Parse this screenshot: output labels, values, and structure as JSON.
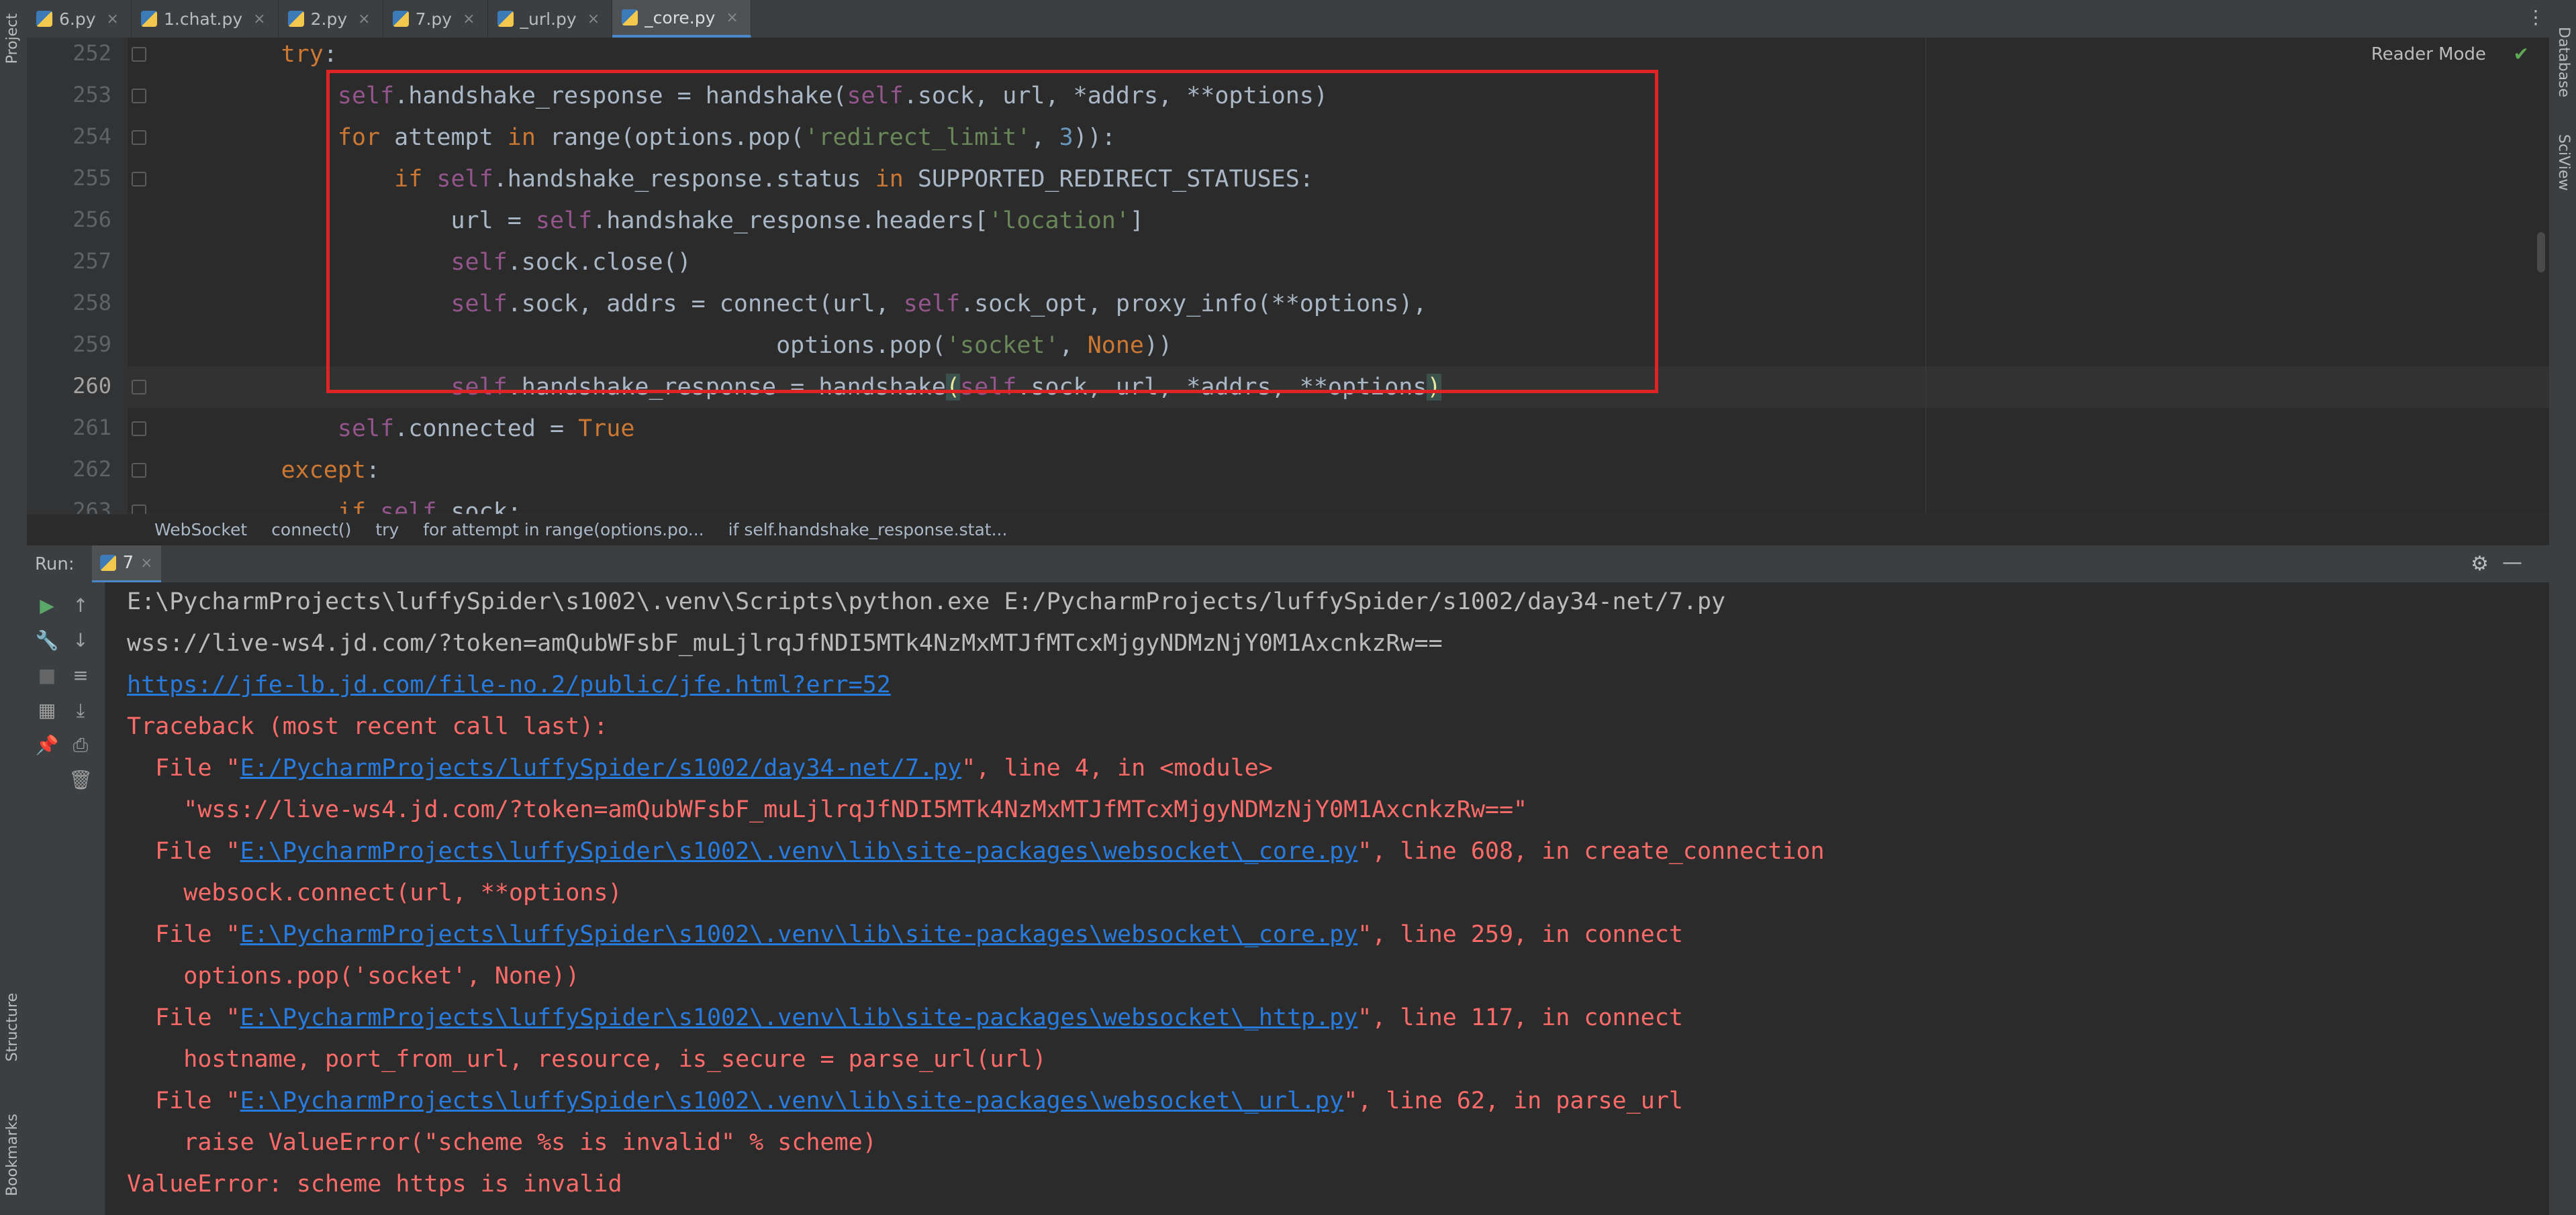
{
  "tabs": [
    {
      "label": "6.py",
      "active": false
    },
    {
      "label": "1.chat.py",
      "active": false
    },
    {
      "label": "2.py",
      "active": false
    },
    {
      "label": "7.py",
      "active": false
    },
    {
      "label": "_url.py",
      "active": false
    },
    {
      "label": "_core.py",
      "active": true
    }
  ],
  "left_tools": {
    "project": "Project",
    "structure": "Structure",
    "bookmarks": "Bookmarks"
  },
  "right_tools": {
    "database": "Database",
    "sciview": "SciView"
  },
  "editor": {
    "reader_mode": "Reader Mode",
    "current_line": 260,
    "lines": [
      {
        "n": "252",
        "indent": "        ",
        "tokens": [
          {
            "t": "try",
            "c": "kw"
          },
          {
            "t": ":",
            "c": ""
          }
        ]
      },
      {
        "n": "253",
        "indent": "            ",
        "tokens": [
          {
            "t": "self",
            "c": "self"
          },
          {
            "t": ".handshake_response = handshake(",
            "c": ""
          },
          {
            "t": "self",
            "c": "self"
          },
          {
            "t": ".sock, url, *addrs, **options)",
            "c": ""
          }
        ]
      },
      {
        "n": "254",
        "indent": "            ",
        "tokens": [
          {
            "t": "for",
            "c": "kw"
          },
          {
            "t": " attempt ",
            "c": ""
          },
          {
            "t": "in",
            "c": "kw"
          },
          {
            "t": " range(options.pop(",
            "c": ""
          },
          {
            "t": "'redirect_limit'",
            "c": "str"
          },
          {
            "t": ", ",
            "c": ""
          },
          {
            "t": "3",
            "c": "num"
          },
          {
            "t": ")):",
            "c": ""
          }
        ]
      },
      {
        "n": "255",
        "indent": "                ",
        "tokens": [
          {
            "t": "if",
            "c": "kw"
          },
          {
            "t": " ",
            "c": ""
          },
          {
            "t": "self",
            "c": "self"
          },
          {
            "t": ".handshake_response.status ",
            "c": ""
          },
          {
            "t": "in",
            "c": "kw"
          },
          {
            "t": " SUPPORTED_REDIRECT_STATUSES:",
            "c": ""
          }
        ]
      },
      {
        "n": "256",
        "indent": "                    ",
        "tokens": [
          {
            "t": "url = ",
            "c": ""
          },
          {
            "t": "self",
            "c": "self"
          },
          {
            "t": ".handshake_response.headers[",
            "c": ""
          },
          {
            "t": "'location'",
            "c": "str"
          },
          {
            "t": "]",
            "c": ""
          }
        ]
      },
      {
        "n": "257",
        "indent": "                    ",
        "tokens": [
          {
            "t": "self",
            "c": "self"
          },
          {
            "t": ".sock.close()",
            "c": ""
          }
        ]
      },
      {
        "n": "258",
        "indent": "                    ",
        "tokens": [
          {
            "t": "self",
            "c": "self"
          },
          {
            "t": ".sock, addrs = connect(url, ",
            "c": ""
          },
          {
            "t": "self",
            "c": "self"
          },
          {
            "t": ".sock_opt, proxy_info(**options),",
            "c": ""
          }
        ]
      },
      {
        "n": "259",
        "indent": "                                           ",
        "tokens": [
          {
            "t": "options.pop(",
            "c": ""
          },
          {
            "t": "'socket'",
            "c": "str"
          },
          {
            "t": ", ",
            "c": ""
          },
          {
            "t": "None",
            "c": "kw"
          },
          {
            "t": "))",
            "c": ""
          }
        ]
      },
      {
        "n": "260",
        "indent": "                    ",
        "tokens": [
          {
            "t": "self",
            "c": "self"
          },
          {
            "t": ".handshake_response = handshake",
            "c": ""
          },
          {
            "t": "(",
            "c": "brk"
          },
          {
            "t": "self",
            "c": "self"
          },
          {
            "t": ".sock, url, *addrs, **options",
            "c": ""
          },
          {
            "t": ")",
            "c": "brk"
          }
        ]
      },
      {
        "n": "261",
        "indent": "            ",
        "tokens": [
          {
            "t": "self",
            "c": "self"
          },
          {
            "t": ".connected = ",
            "c": ""
          },
          {
            "t": "True",
            "c": "kw"
          }
        ]
      },
      {
        "n": "262",
        "indent": "        ",
        "tokens": [
          {
            "t": "except",
            "c": "kw"
          },
          {
            "t": ":",
            "c": ""
          }
        ]
      },
      {
        "n": "263",
        "indent": "            ",
        "tokens": [
          {
            "t": "if",
            "c": "kw"
          },
          {
            "t": " ",
            "c": ""
          },
          {
            "t": "self",
            "c": "self"
          },
          {
            "t": ".sock:",
            "c": ""
          }
        ]
      }
    ]
  },
  "breadcrumb": [
    "WebSocket",
    "connect()",
    "try",
    "for attempt in range(options.po...",
    "if self.handshake_response.stat..."
  ],
  "run": {
    "label": "Run:",
    "tab": "7",
    "output": [
      {
        "cls": "gray",
        "parts": [
          {
            "t": "E:\\PycharmProjects\\luffySpider\\s1002\\.venv\\Scripts\\python.exe E:/PycharmProjects/luffySpider/s1002/day34-net/7.py"
          }
        ]
      },
      {
        "cls": "gray",
        "parts": [
          {
            "t": "wss://live-ws4.jd.com/?token=amQubWFsbF_muLjlrqJfNDI5MTk4NzMxMTJfMTcxMjgyNDMzNjY0M1AxcnkzRw=="
          }
        ]
      },
      {
        "cls": "gray",
        "parts": [
          {
            "t": "https://jfe-lb.jd.com/file-no.2/public/jfe.html?err=52",
            "link": true
          }
        ]
      },
      {
        "cls": "red",
        "parts": [
          {
            "t": "Traceback (most recent call last):"
          }
        ]
      },
      {
        "cls": "red",
        "parts": [
          {
            "t": "  File \""
          },
          {
            "t": "E:/PycharmProjects/luffySpider/s1002/day34-net/7.py",
            "link": true
          },
          {
            "t": "\", line 4, in <module>"
          }
        ]
      },
      {
        "cls": "red",
        "parts": [
          {
            "t": "    \"wss://live-ws4.jd.com/?token=amQubWFsbF_muLjlrqJfNDI5MTk4NzMxMTJfMTcxMjgyNDMzNjY0M1AxcnkzRw==\""
          }
        ]
      },
      {
        "cls": "red",
        "parts": [
          {
            "t": "  File \""
          },
          {
            "t": "E:\\PycharmProjects\\luffySpider\\s1002\\.venv\\lib\\site-packages\\websocket\\_core.py",
            "link": true
          },
          {
            "t": "\", line 608, in create_connection"
          }
        ]
      },
      {
        "cls": "red",
        "parts": [
          {
            "t": "    websock.connect(url, **options)"
          }
        ]
      },
      {
        "cls": "red",
        "parts": [
          {
            "t": "  File \""
          },
          {
            "t": "E:\\PycharmProjects\\luffySpider\\s1002\\.venv\\lib\\site-packages\\websocket\\_core.py",
            "link": true
          },
          {
            "t": "\", line 259, in connect"
          }
        ]
      },
      {
        "cls": "red",
        "parts": [
          {
            "t": "    options.pop('socket', None))"
          }
        ]
      },
      {
        "cls": "red",
        "parts": [
          {
            "t": "  File \""
          },
          {
            "t": "E:\\PycharmProjects\\luffySpider\\s1002\\.venv\\lib\\site-packages\\websocket\\_http.py",
            "link": true
          },
          {
            "t": "\", line 117, in connect"
          }
        ]
      },
      {
        "cls": "red",
        "parts": [
          {
            "t": "    hostname, port_from_url, resource, is_secure = parse_url(url)"
          }
        ]
      },
      {
        "cls": "red",
        "parts": [
          {
            "t": "  File \""
          },
          {
            "t": "E:\\PycharmProjects\\luffySpider\\s1002\\.venv\\lib\\site-packages\\websocket\\_url.py",
            "link": true
          },
          {
            "t": "\", line 62, in parse_url"
          }
        ]
      },
      {
        "cls": "red",
        "parts": [
          {
            "t": "    raise ValueError(\"scheme %s is invalid\" % scheme)"
          }
        ]
      },
      {
        "cls": "red",
        "parts": [
          {
            "t": "ValueError: scheme https is invalid"
          }
        ]
      }
    ]
  },
  "icons": {
    "tab_file": "python-file-icon",
    "more": "more-vertical-icon",
    "check": "check-icon",
    "run": "play-icon",
    "settings": "gear-icon",
    "minimize": "minimize-icon"
  },
  "colors": {
    "keyword": "#cc7832",
    "self": "#94558d",
    "string": "#6a8759",
    "number": "#6897bb",
    "error": "#ff6b68",
    "link": "#287bde",
    "highlight_box": "#e02424",
    "accent": "#4a88c7"
  }
}
